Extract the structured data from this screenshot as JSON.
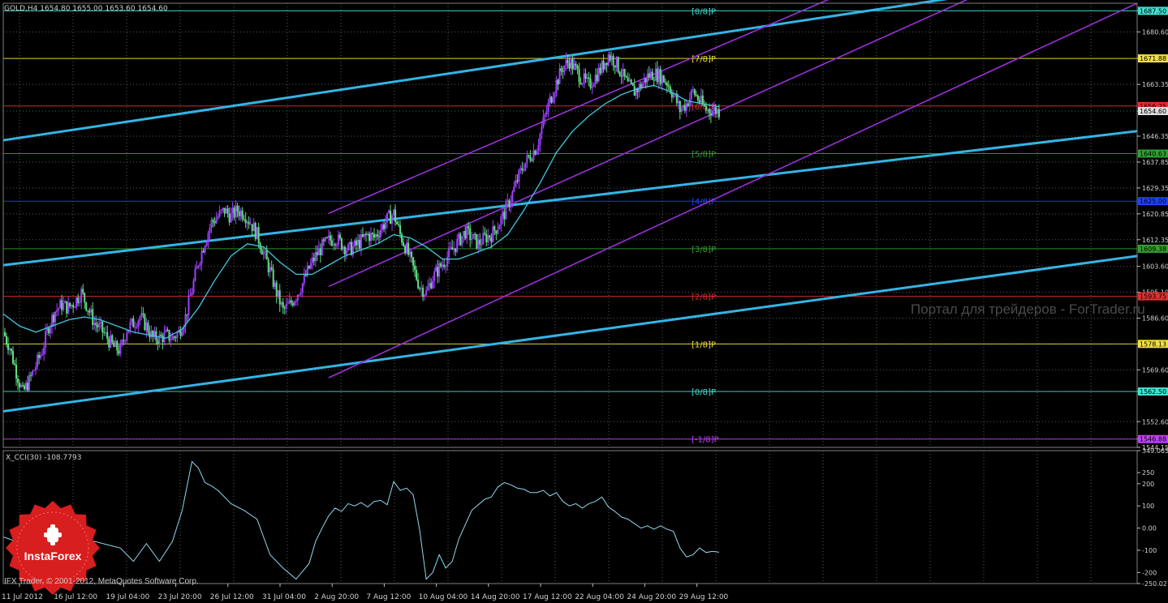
{
  "header": {
    "title": "GOLD,H4  1654.80 1655.00 1653.60 1654.60"
  },
  "cci_label": "X_CCI(30) -108.7793",
  "watermark": "Портал для трейдеров - ForTrader.ru",
  "copyright": "IFX Trader, © 2001-2012, MetaQuotes Software Corp.",
  "logo": {
    "text": "InstaForex",
    "color": "#d81e1e"
  },
  "colors": {
    "background": "#000000",
    "grid": "#5a5a5a",
    "up_candle": "#a040ff",
    "down_candle": "#60e080",
    "ma": "#40c8e0",
    "channel_blue": "#33b5e5",
    "channel_purple": "#9b30d9",
    "cci": "#8fd8f0"
  },
  "chart_data": [
    {
      "type": "candlestick",
      "title": "GOLD,H4",
      "ylim": [
        1544.15,
        1690.0
      ],
      "price_ticks": [
        "1687.50",
        "1680.60",
        "1671.88",
        "1663.35",
        "1654.60",
        "1646.35",
        "1637.85",
        "1629.35",
        "1620.85",
        "1612.35",
        "1603.60",
        "1595.10",
        "1586.60",
        "1578.13",
        "1569.60",
        "1562.50",
        "1552.60",
        "1546.88",
        "1544.15"
      ],
      "highlighted_prices": [
        "1687.50",
        "1671.88",
        "1656.25",
        "1654.60",
        "1640.63",
        "1625.00",
        "1609.38",
        "1593.75",
        "1578.13",
        "1562.50",
        "1546.88"
      ],
      "time_labels": [
        "11 Jul 2012",
        "16 Jul 12:00",
        "19 Jul 04:00",
        "23 Jul 20:00",
        "26 Jul 12:00",
        "31 Jul 04:00",
        "2 Aug 20:00",
        "7 Aug 12:00",
        "10 Aug 04:00",
        "14 Aug 20:00",
        "17 Aug 12:00",
        "22 Aug 04:00",
        "24 Aug 20:00",
        "29 Aug 12:00"
      ],
      "murrey_levels": [
        {
          "label": "[8/8]P",
          "price": 1687.5,
          "color": "#40e0d0"
        },
        {
          "label": "[7/8]P",
          "price": 1671.88,
          "color": "#f0e040"
        },
        {
          "label": "[6/8]P",
          "price": 1656.25,
          "color": "#e03030"
        },
        {
          "label": "[5/8]P",
          "price": 1640.63,
          "color": "#30a030"
        },
        {
          "label": "[4/8]P",
          "price": 1625.0,
          "color": "#2040ff"
        },
        {
          "label": "[3/8]P",
          "price": 1609.38,
          "color": "#30a030"
        },
        {
          "label": "[2/8]P",
          "price": 1593.75,
          "color": "#e03030"
        },
        {
          "label": "[1/8]P",
          "price": 1578.13,
          "color": "#f0e040"
        },
        {
          "label": "[0/8]P",
          "price": 1562.5,
          "color": "#40e0d0"
        },
        {
          "label": "[-1/8]P",
          "price": 1546.88,
          "color": "#c040ff"
        }
      ],
      "close_path": [
        [
          0,
          1582
        ],
        [
          4,
          1577
        ],
        [
          8,
          1569
        ],
        [
          12,
          1562
        ],
        [
          16,
          1566
        ],
        [
          20,
          1571
        ],
        [
          24,
          1576
        ],
        [
          28,
          1584
        ],
        [
          32,
          1589
        ],
        [
          36,
          1591
        ],
        [
          40,
          1590
        ],
        [
          44,
          1592
        ],
        [
          48,
          1595
        ],
        [
          52,
          1590
        ],
        [
          56,
          1585
        ],
        [
          60,
          1583
        ],
        [
          64,
          1580
        ],
        [
          68,
          1577
        ],
        [
          72,
          1576
        ],
        [
          76,
          1583
        ],
        [
          80,
          1585
        ],
        [
          84,
          1587
        ],
        [
          88,
          1584
        ],
        [
          92,
          1580
        ],
        [
          96,
          1580
        ],
        [
          100,
          1581
        ],
        [
          104,
          1580
        ],
        [
          108,
          1582
        ],
        [
          112,
          1587
        ],
        [
          116,
          1596
        ],
        [
          120,
          1605
        ],
        [
          124,
          1612
        ],
        [
          128,
          1618
        ],
        [
          132,
          1620
        ],
        [
          136,
          1622
        ],
        [
          140,
          1620
        ],
        [
          144,
          1622
        ],
        [
          148,
          1621
        ],
        [
          152,
          1618
        ],
        [
          156,
          1614
        ],
        [
          160,
          1608
        ],
        [
          164,
          1602
        ],
        [
          168,
          1595
        ],
        [
          172,
          1589
        ],
        [
          176,
          1591
        ],
        [
          180,
          1594
        ],
        [
          184,
          1598
        ],
        [
          188,
          1603
        ],
        [
          192,
          1607
        ],
        [
          196,
          1610
        ],
        [
          200,
          1612
        ],
        [
          204,
          1613
        ],
        [
          208,
          1611
        ],
        [
          212,
          1609
        ],
        [
          216,
          1610
        ],
        [
          220,
          1612
        ],
        [
          224,
          1614
        ],
        [
          228,
          1613
        ],
        [
          232,
          1616
        ],
        [
          236,
          1619
        ],
        [
          240,
          1621
        ],
        [
          244,
          1614
        ],
        [
          248,
          1609
        ],
        [
          252,
          1603
        ],
        [
          256,
          1597
        ],
        [
          260,
          1595
        ],
        [
          264,
          1600
        ],
        [
          268,
          1603
        ],
        [
          272,
          1606
        ],
        [
          276,
          1609
        ],
        [
          280,
          1612
        ],
        [
          284,
          1615
        ],
        [
          288,
          1613
        ],
        [
          292,
          1611
        ],
        [
          296,
          1613
        ],
        [
          300,
          1614
        ],
        [
          304,
          1617
        ],
        [
          308,
          1621
        ],
        [
          312,
          1626
        ],
        [
          316,
          1632
        ],
        [
          320,
          1637
        ],
        [
          324,
          1640
        ],
        [
          328,
          1643
        ],
        [
          332,
          1651
        ],
        [
          336,
          1658
        ],
        [
          340,
          1664
        ],
        [
          344,
          1669
        ],
        [
          348,
          1671
        ],
        [
          352,
          1668
        ],
        [
          356,
          1665
        ],
        [
          360,
          1663
        ],
        [
          364,
          1666
        ],
        [
          368,
          1669
        ],
        [
          372,
          1673
        ],
        [
          376,
          1671
        ],
        [
          380,
          1667
        ],
        [
          384,
          1663
        ],
        [
          388,
          1661
        ],
        [
          392,
          1663
        ],
        [
          396,
          1666
        ],
        [
          400,
          1667
        ],
        [
          404,
          1666
        ],
        [
          408,
          1664
        ],
        [
          412,
          1660
        ],
        [
          416,
          1655
        ],
        [
          420,
          1657
        ],
        [
          424,
          1661
        ],
        [
          428,
          1658
        ],
        [
          432,
          1655
        ],
        [
          436,
          1655
        ],
        [
          440,
          1654.6
        ]
      ],
      "ma_path": [
        [
          0,
          1588
        ],
        [
          10,
          1584
        ],
        [
          20,
          1582
        ],
        [
          30,
          1584
        ],
        [
          40,
          1586
        ],
        [
          50,
          1587
        ],
        [
          60,
          1586
        ],
        [
          70,
          1584
        ],
        [
          80,
          1582
        ],
        [
          90,
          1581
        ],
        [
          100,
          1580
        ],
        [
          110,
          1583
        ],
        [
          120,
          1590
        ],
        [
          130,
          1599
        ],
        [
          140,
          1607
        ],
        [
          150,
          1611
        ],
        [
          160,
          1610
        ],
        [
          170,
          1605
        ],
        [
          180,
          1601
        ],
        [
          190,
          1601
        ],
        [
          200,
          1604
        ],
        [
          210,
          1607
        ],
        [
          220,
          1609
        ],
        [
          230,
          1611
        ],
        [
          240,
          1614
        ],
        [
          250,
          1613
        ],
        [
          260,
          1610
        ],
        [
          270,
          1606
        ],
        [
          280,
          1606
        ],
        [
          290,
          1608
        ],
        [
          300,
          1610
        ],
        [
          310,
          1614
        ],
        [
          320,
          1622
        ],
        [
          330,
          1631
        ],
        [
          340,
          1641
        ],
        [
          350,
          1648
        ],
        [
          360,
          1653
        ],
        [
          370,
          1657
        ],
        [
          380,
          1660
        ],
        [
          390,
          1662
        ],
        [
          400,
          1663
        ],
        [
          410,
          1661
        ],
        [
          420,
          1658
        ],
        [
          430,
          1657
        ],
        [
          440,
          1656
        ]
      ],
      "channel_lines": [
        {
          "color": "#33b5e5",
          "from": [
            0,
            1645
          ],
          "to": [
            600,
            1693
          ]
        },
        {
          "color": "#33b5e5",
          "from": [
            0,
            1604
          ],
          "to": [
            697,
            1648
          ]
        },
        {
          "color": "#33b5e5",
          "from": [
            0,
            1556
          ],
          "to": [
            697,
            1607
          ]
        },
        {
          "color": "#9b30d9",
          "from": [
            200,
            1621
          ],
          "to": [
            515,
            1693
          ]
        },
        {
          "color": "#9b30d9",
          "from": [
            200,
            1597
          ],
          "to": [
            600,
            1693
          ]
        },
        {
          "color": "#9b30d9",
          "from": [
            200,
            1567
          ],
          "to": [
            697,
            1690
          ]
        }
      ]
    },
    {
      "type": "line",
      "title": "X_CCI(30) -108.7793",
      "ylim": [
        -250,
        349.065
      ],
      "ticks": [
        "349.065",
        "250",
        "200",
        "100",
        "0.00",
        "-100",
        "-200",
        "-250.027"
      ],
      "x": [
        0,
        8,
        16,
        24,
        32,
        40,
        48,
        56,
        64,
        72,
        80,
        88,
        96,
        104,
        110,
        116,
        120,
        124,
        128,
        132,
        140,
        148,
        156,
        164,
        172,
        180,
        188,
        192,
        196,
        200,
        204,
        208,
        212,
        216,
        220,
        224,
        228,
        232,
        236,
        240,
        244,
        248,
        252,
        256,
        260,
        264,
        268,
        272,
        276,
        280,
        284,
        288,
        292,
        296,
        300,
        304,
        308,
        312,
        316,
        320,
        324,
        328,
        332,
        336,
        340,
        344,
        348,
        352,
        356,
        360,
        364,
        368,
        372,
        376,
        380,
        384,
        388,
        392,
        396,
        400,
        404,
        408,
        412,
        416,
        420,
        424,
        428,
        432,
        436,
        440
      ],
      "values": [
        -40,
        -60,
        -80,
        -50,
        -20,
        -10,
        -35,
        -60,
        -75,
        -90,
        -150,
        -70,
        -150,
        -60,
        80,
        300,
        270,
        205,
        190,
        170,
        110,
        80,
        40,
        -120,
        -180,
        -230,
        -160,
        -60,
        0,
        55,
        90,
        75,
        110,
        100,
        115,
        95,
        120,
        125,
        105,
        210,
        170,
        180,
        150,
        -10,
        -230,
        -200,
        -120,
        -180,
        -150,
        -50,
        15,
        80,
        105,
        130,
        140,
        185,
        205,
        195,
        180,
        175,
        160,
        160,
        170,
        145,
        160,
        120,
        100,
        110,
        90,
        110,
        120,
        140,
        95,
        75,
        50,
        40,
        20,
        0,
        10,
        -5,
        10,
        -5,
        -15,
        -90,
        -130,
        -120,
        -90,
        -110,
        -105,
        -108.8
      ]
    }
  ]
}
